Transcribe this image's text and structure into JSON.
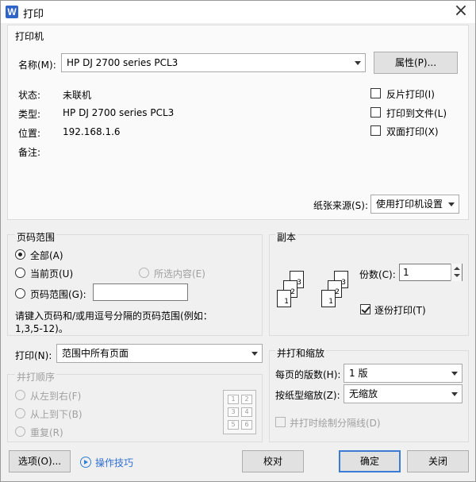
{
  "window": {
    "title": "打印",
    "app_icon": "W"
  },
  "printer": {
    "group_title": "打印机",
    "name_label": "名称(M):",
    "name_value": "HP DJ 2700 series PCL3",
    "properties_button": "属性(P)...",
    "status_label": "状态:",
    "status_value": "未联机",
    "type_label": "类型:",
    "type_value": "HP DJ 2700 series PCL3",
    "location_label": "位置:",
    "location_value": "192.168.1.6",
    "comment_label": "备注:",
    "comment_value": "",
    "options": [
      {
        "label": "反片打印(I)",
        "checked": false
      },
      {
        "label": "打印到文件(L)",
        "checked": false
      },
      {
        "label": "双面打印(X)",
        "checked": false
      }
    ],
    "paper_source_label": "纸张来源(S):",
    "paper_source_value": "使用打印机设置"
  },
  "page_range": {
    "group_title": "页码范围",
    "all_label": "全部(A)",
    "current_label": "当前页(U)",
    "selection_label": "所选内容(E)",
    "range_label": "页码范围(G):",
    "range_value": "",
    "selected": "all",
    "hint": "请键入页码和/或用逗号分隔的页码范围(例如：",
    "hint_example": "1,3,5-12)。"
  },
  "copies": {
    "group_title": "副本",
    "count_label": "份数(C):",
    "count_value": "1",
    "collate_label": "逐份打印(T)",
    "collate_checked": true,
    "stack_a": [
      "3",
      "2",
      "1"
    ],
    "stack_b": [
      "3",
      "2",
      "1"
    ]
  },
  "print_what": {
    "label": "打印(N):",
    "value": "范围中所有页面"
  },
  "order": {
    "group_title": "并打顺序",
    "left_to_right": "从左到右(F)",
    "top_to_bottom": "从上到下(B)",
    "repeat": "重复(R)",
    "grid": [
      "1",
      "2",
      "3",
      "4",
      "5",
      "6"
    ]
  },
  "zoom": {
    "group_title": "并打和缩放",
    "pages_per_sheet_label": "每页的版数(H):",
    "pages_per_sheet_value": "1 版",
    "scale_label": "按纸型缩放(Z):",
    "scale_value": "无缩放",
    "draw_border_label": "并打时绘制分隔线(D)"
  },
  "footer": {
    "options_button": "选项(O)...",
    "tips_link": "操作技巧",
    "proofread_button": "校对",
    "ok_button": "确定",
    "close_button": "关闭"
  },
  "colors": {
    "accent": "#2f6fd5",
    "primary_border": "#3a7bd5"
  }
}
